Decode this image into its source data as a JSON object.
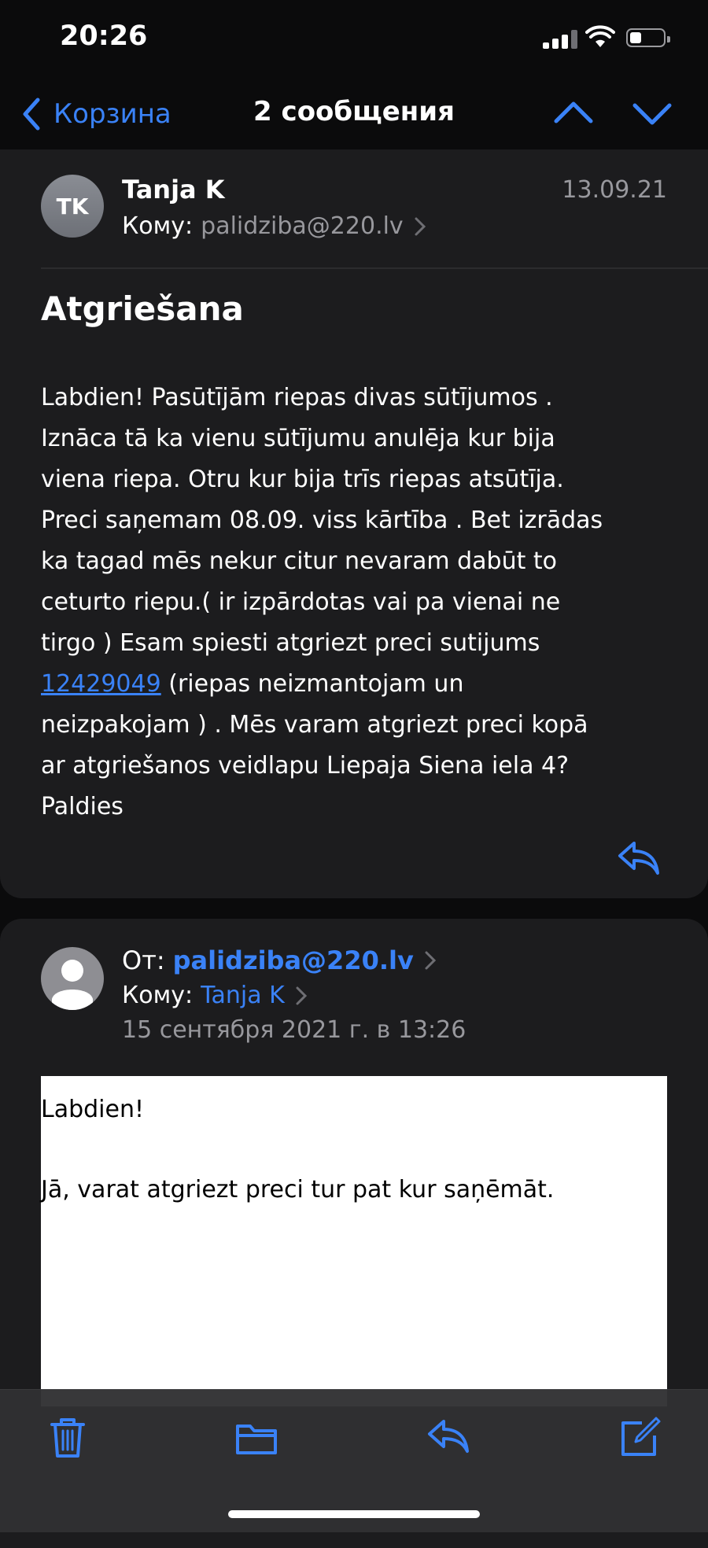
{
  "status": {
    "time": "20:26"
  },
  "nav": {
    "back_label": "Корзина",
    "title": "2 сообщения"
  },
  "message1": {
    "avatar_initials": "TK",
    "sender": "Tanja K",
    "date": "13.09.21",
    "to_label": "Кому:",
    "to_address": "palidziba@220.lv",
    "subject": "Atgriešana",
    "body_before_link": "Labdien! Pasūtījām riepas divas sūtījumos .\nIznāca tā ka vienu sūtījumu anulēja kur bija\nviena riepa. Otru kur bija trīs riepas atsūtīja.\nPreci saņemam 08.09.  viss kārtība . Bet izrādas\nka tagad mēs nekur citur nevaram dabūt to\nceturto riepu.( ir izpārdotas vai pa vienai ne\ntirgo )  Esam spiesti atgriezt preci sutijums\n",
    "body_link": "12429049",
    "body_after_link": " (riepas neizmantojam un\nneizpakojam ) . Mēs varam atgriezt preci kopā\nar atgriešanos veidlapu Liepaja Siena iela 4?\nPaldies"
  },
  "message2": {
    "from_label": "От:",
    "from_address": "palidziba@220.lv",
    "to_label": "Кому:",
    "to_name": "Tanja K",
    "date": "15 сентября 2021 г. в 13:26",
    "body_line1": "Labdien!",
    "body_line2": "Jā, varat atgriezt preci tur pat kur saņēmāt."
  },
  "colors": {
    "accent": "#3a82f7",
    "background": "#0b0b0c",
    "card": "#1c1c1e",
    "secondary_text": "#98989d"
  },
  "icons": [
    "chevron-left-icon",
    "chevron-up-icon",
    "chevron-down-icon",
    "reply-icon",
    "trash-icon",
    "folder-icon",
    "compose-icon"
  ]
}
